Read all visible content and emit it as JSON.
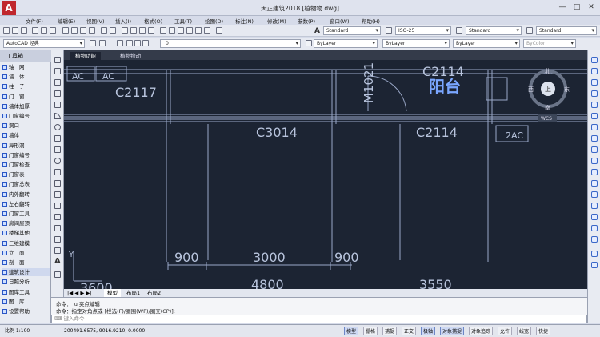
{
  "app": {
    "title": "天正建筑2018    [植物物.dwg]",
    "logo": "A"
  },
  "menu": [
    "文件(F)",
    "编辑(E)",
    "视图(V)",
    "插入(I)",
    "格式(O)",
    "工具(T)",
    "绘图(D)",
    "标注(N)",
    "修改(M)",
    "参数(P)",
    "窗口(W)",
    "帮助(H)"
  ],
  "toolbar": {
    "textstyle_icon": "A",
    "textstyle": "Standard",
    "dimstyle": "ISO-25",
    "tablestyle": "Standard",
    "mleaderstyle": "Standard",
    "workspace": "AutoCAD 经典",
    "layer": "_0",
    "color": "ByLayer",
    "linetype": "ByLayer",
    "lineweight": "ByLayer",
    "plotstyle": "ByColor"
  },
  "palette": {
    "title": "工具箱",
    "items": [
      "轴　网",
      "墙　体",
      "柱　子",
      "门　窗",
      "墙体加厚",
      "门窗编号",
      "洞口",
      "墙体",
      "异形洞",
      "门窗编号",
      "门窗检查",
      "门窗表",
      "门窗总表",
      "内外翻转",
      "左右翻转",
      "门窗工具",
      "房间屋顶",
      "楼梯其他",
      "三维建模",
      "立　面",
      "剖　面",
      "建筑设计",
      "日照分析",
      "图库工具",
      "图　库",
      "设置帮助"
    ],
    "selected_index": 21
  },
  "doc_tabs": [
    "植物功能",
    "植物物动"
  ],
  "drawing": {
    "labels_top": [
      "AC",
      "AC",
      "C2117",
      "M1021",
      "C2114",
      "阳台"
    ],
    "windows": [
      "C3014",
      "C2114"
    ],
    "tag": "2AC",
    "dims": [
      "900",
      "3000",
      "900"
    ],
    "dims_second": [
      "4800",
      "3550",
      "3600"
    ],
    "ucs_y": "Y"
  },
  "viewcube": {
    "north": "北",
    "south": "南",
    "east": "东",
    "west": "西",
    "center": "上",
    "wcs": "WCS"
  },
  "layout_tabs": [
    "模型",
    "布局1",
    "布局2"
  ],
  "cmd": {
    "line1": "命令：_u  夹点编辑",
    "line2": "命令：指定对角点或 [栏选(F)/圈围(WP)/圈交(CP)]:",
    "prompt": "键入命令"
  },
  "status": {
    "scale": "比例 1:100",
    "coords": "200491.6575, 9016.9210, 0.0000",
    "buttons": [
      "模型",
      "栅格",
      "捕捉",
      "正交",
      "极轴",
      "对象捕捉",
      "对象追踪",
      "允许",
      "线宽",
      "快捷"
    ],
    "active": [
      0,
      4,
      5
    ]
  }
}
